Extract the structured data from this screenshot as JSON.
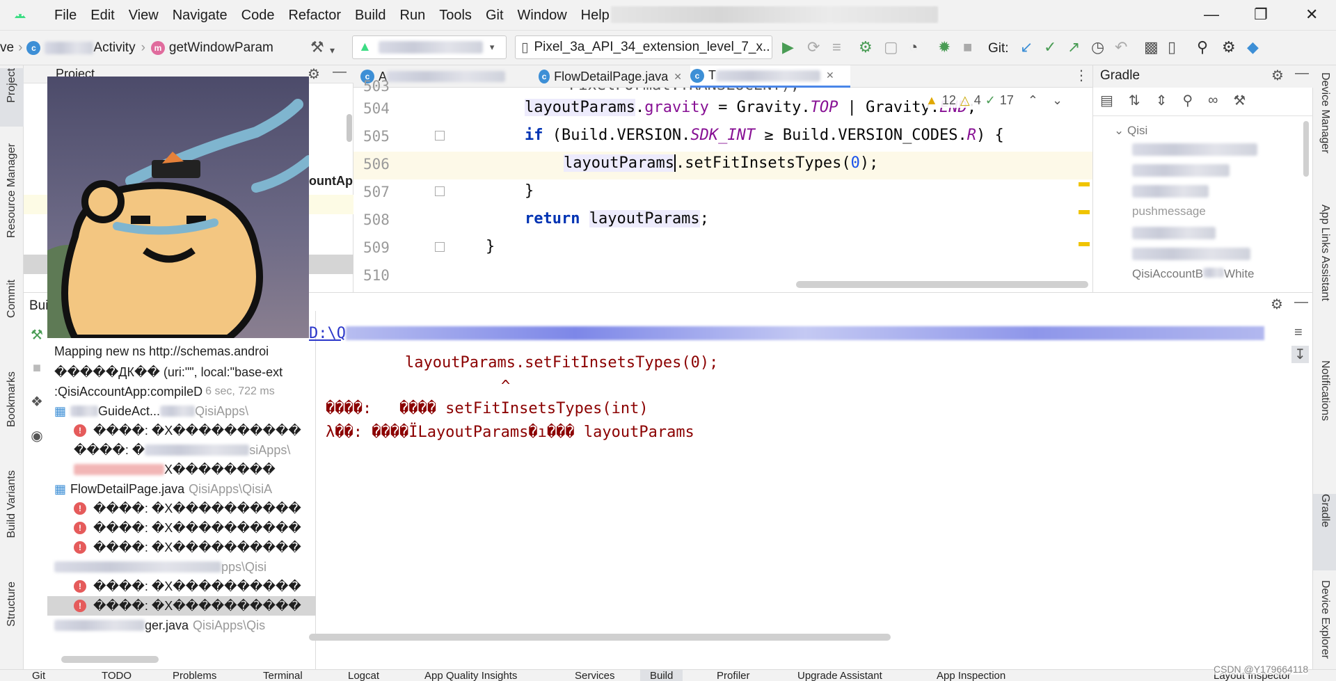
{
  "menu": [
    "File",
    "Edit",
    "View",
    "Navigate",
    "Code",
    "Refactor",
    "Build",
    "Run",
    "Tools",
    "Git",
    "Window",
    "Help"
  ],
  "toolbar": {
    "crumb_prefix": "ve",
    "crumb_class": "Activity",
    "crumb_method": "getWindowParam",
    "device": "Pixel_3a_API_34_extension_level_7_x..",
    "git_label": "Git:"
  },
  "left_stripe": [
    "Project",
    "Resource Manager",
    "Commit",
    "Bookmarks",
    "Build Variants",
    "Structure"
  ],
  "right_stripe": [
    "Device Manager",
    "App Links Assistant",
    "Notifications",
    "Gradle",
    "Device Explorer"
  ],
  "project_panel": {
    "title": "Project",
    "partial_label": "ountApp"
  },
  "editor": {
    "tabs": [
      {
        "label": "A"
      },
      {
        "label": "FlowDetailPage.java"
      },
      {
        "label": "T"
      }
    ],
    "inspections": {
      "warnings": "12",
      "weak_warnings": "4",
      "typos": "17"
    },
    "lines": [
      {
        "number": "503",
        "text": "        PixelFormat.TRANSLUCENT);"
      },
      {
        "number": "504",
        "text": "layoutParams.gravity = Gravity.TOP | Gravity.END;"
      },
      {
        "number": "505",
        "text": "if (Build.VERSION.SDK_INT >= Build.VERSION_CODES.R) {"
      },
      {
        "number": "506",
        "text": "layoutParams.setFitInsetsTypes(0);"
      },
      {
        "number": "507",
        "text": "}"
      },
      {
        "number": "508",
        "text": "return layoutParams;"
      },
      {
        "number": "509",
        "text": "}"
      },
      {
        "number": "510",
        "text": ""
      }
    ]
  },
  "gradle": {
    "title": "Gradle",
    "items": [
      "Qisi",
      "pushmessage",
      "QisiAccountB",
      "White"
    ]
  },
  "build": {
    "title": "Bui",
    "tree": [
      {
        "text": "Mapping new ns http://schemas.androi",
        "type": "info"
      },
      {
        "text": "�����ДК�� (uri:\"\", local:\"base-ext",
        "type": "info"
      },
      {
        "text": ":QisiAccountApp:compileD",
        "meta": "6 sec, 722 ms",
        "type": "task"
      },
      {
        "text": "GuideAct...",
        "meta": "QisiApps\\",
        "type": "file"
      },
      {
        "text": "����: �X����������",
        "type": "error"
      },
      {
        "text": "����: �",
        "meta": "siApps\\",
        "type": "error"
      },
      {
        "text": "X��������",
        "type": "error"
      },
      {
        "text": "FlowDetailPage.java",
        "meta": "QisiApps\\QisiA",
        "type": "file"
      },
      {
        "text": "����: �X����������",
        "type": "error"
      },
      {
        "text": "����: �X����������",
        "type": "error"
      },
      {
        "text": "����: �X����������",
        "type": "error"
      },
      {
        "text": "",
        "meta": "pps\\Qisi",
        "type": "file"
      },
      {
        "text": "����: �X����������",
        "type": "error"
      },
      {
        "text": "����: �X����������",
        "type": "error"
      },
      {
        "text": "ger.java",
        "meta": "QisiApps\\Qis",
        "type": "file"
      }
    ],
    "console": {
      "path": "D:\\Q",
      "code": "layoutParams.setFitInsetsTypes(0);",
      "caret": "^",
      "symbol_line": "����:   ���� setFitInsetsTypes(int)",
      "location_line": "λ��: ����ÏLayoutParams�ı��� layoutParams"
    }
  },
  "statusbar": [
    "Git",
    "TODO",
    "Problems",
    "Terminal",
    "Logcat",
    "App Quality Insights",
    "Services",
    "Build",
    "Profiler",
    "Upgrade Assistant",
    "App Inspection",
    "Layout Inspector"
  ],
  "watermark": "CSDN @Y179664118",
  "colors": {
    "keyword": "#0033b3",
    "field": "#871094",
    "error_text": "#8b0000",
    "accent": "#4a86e8",
    "run_green": "#499c54"
  }
}
